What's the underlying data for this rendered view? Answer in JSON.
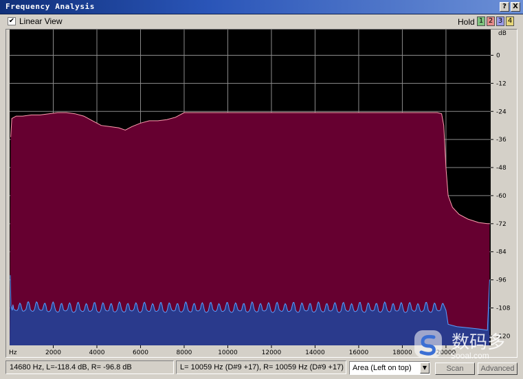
{
  "window": {
    "title": "Frequency Analysis",
    "buttons": {
      "help": "?",
      "close": "X"
    }
  },
  "toolbar": {
    "linear_view_label": "Linear View",
    "linear_view_checked": true,
    "checkmark": "✔",
    "hold_label": "Hold",
    "hold_buttons": [
      {
        "label": "1",
        "color": "#7ec27e"
      },
      {
        "label": "2",
        "color": "#e48a8a"
      },
      {
        "label": "3",
        "color": "#9a9ae6"
      },
      {
        "label": "4",
        "color": "#e6d67a"
      }
    ]
  },
  "chart_data": {
    "type": "area",
    "x_unit_label": "Hz",
    "y_unit_label": "dB",
    "xlim": [
      0,
      22050
    ],
    "ylim": [
      -124,
      11
    ],
    "x_ticks": [
      2000,
      4000,
      6000,
      8000,
      10000,
      12000,
      14000,
      16000,
      18000,
      20000
    ],
    "y_ticks": [
      0,
      -12,
      -24,
      -36,
      -48,
      -60,
      -72,
      -84,
      -96,
      -108,
      -120
    ],
    "grid": true,
    "colors": {
      "background": "#000000",
      "grid": "#8c8c8c",
      "series_a_fill": "#660030",
      "series_a_line": "#ff9fb0",
      "series_b_fill": "#2a3a8c",
      "series_b_line": "#58a0ff"
    },
    "series": [
      {
        "x": [
          0,
          50,
          100,
          300,
          600,
          1000,
          1400,
          1800,
          2200,
          2600,
          3000,
          3400,
          3800,
          4200,
          4600,
          5000,
          5300,
          5600,
          6000,
          6400,
          6800,
          7200,
          7600,
          8000,
          9000,
          10000,
          12000,
          14000,
          16000,
          18000,
          19000,
          19600,
          19800,
          19900,
          20000,
          20100,
          20300,
          20600,
          21000,
          21500,
          21900,
          22000
        ],
        "y": [
          -124,
          -35,
          -27,
          -26,
          -26,
          -25.5,
          -25.5,
          -25,
          -24.5,
          -24.5,
          -25,
          -26,
          -28,
          -30,
          -30.5,
          -31,
          -32,
          -30.5,
          -29,
          -28,
          -28,
          -27.5,
          -26.5,
          -24.5,
          -24.5,
          -24.5,
          -24.5,
          -24.5,
          -24.5,
          -24.5,
          -24.5,
          -24.5,
          -25,
          -30,
          -48,
          -60,
          -65,
          -68,
          -70,
          -71.5,
          -72,
          -72
        ]
      },
      {
        "x": [
          0,
          30,
          60,
          120,
          300,
          600,
          1000,
          2000,
          4000,
          6000,
          8000,
          10000,
          12000,
          14000,
          16000,
          18000,
          19800,
          20000,
          20100,
          20500,
          21000,
          21500,
          21900,
          22000
        ],
        "y": [
          -124,
          -94,
          -107,
          -109,
          -108.5,
          -109,
          -108.5,
          -109,
          -109,
          -109,
          -109,
          -109,
          -109,
          -109,
          -109,
          -109,
          -109,
          -109,
          -115,
          -116,
          -116.5,
          -117,
          -117.5,
          -96
        ]
      }
    ]
  },
  "status": {
    "cursor_readout": "14680 Hz, L=-118.4 dB, R= -96.8 dB",
    "peak_readout": "L=  10059 Hz (D#9 +17), R=  10059 Hz (D#9 +17)",
    "view_mode": "Area (Left on top)",
    "scan_label": "Scan",
    "advanced_label": "Advanced"
  },
  "watermark": {
    "name": "数码多",
    "url": "Sooal.com"
  }
}
